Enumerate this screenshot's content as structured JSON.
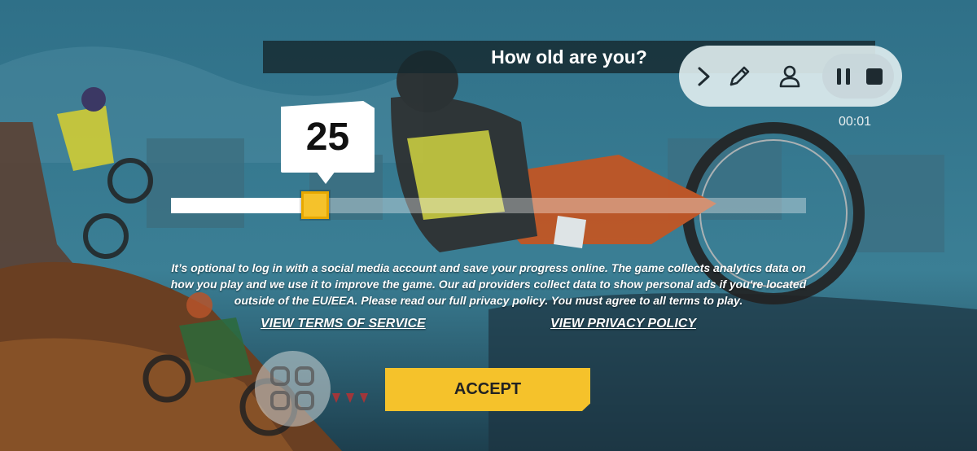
{
  "dialog": {
    "title": "How old are you?",
    "age_value": "25",
    "age_slider_fraction": 0.227,
    "disclaimer": "It’s optional to log in with a social media account and save your progress online. The game collects analytics data on how you play and we use it to improve the game. Our ad providers collect data to show personal ads if you're located outside of the EU/EEA. Please read our full privacy policy. You must agree to all terms to play.",
    "terms_link": "VIEW TERMS OF SERVICE",
    "privacy_link": "VIEW PRIVACY POLICY",
    "accept_label": "ACCEPT"
  },
  "recorder": {
    "timer": "00:01",
    "icons": [
      "chevron-right-icon",
      "pencil-icon",
      "person-icon",
      "pause-icon",
      "stop-icon"
    ]
  },
  "colors": {
    "accent": "#f5c22b",
    "banner": "#16282e",
    "sky": "#2f6f86"
  }
}
